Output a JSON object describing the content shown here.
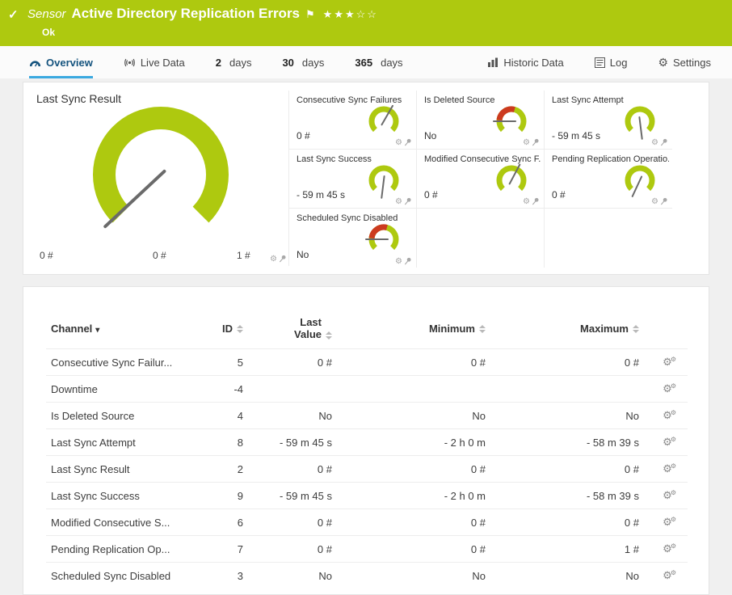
{
  "colors": {
    "brand_green": "#AEC90F",
    "accent_blue": "#3BA9E0",
    "gauge_red": "#CC3A1F",
    "needle": "#6A6A6A"
  },
  "icons": {
    "gear": "⚙",
    "caret_down": "▾"
  },
  "header": {
    "check_icon": "✓",
    "type_label": "Sensor",
    "title": "Active Directory Replication Errors",
    "flag_icon": "⚑",
    "rating": "★★★☆☆",
    "status": "Ok"
  },
  "tabs": {
    "overview": "Overview",
    "live_data": "Live Data",
    "days2_num": "2",
    "days2_label": "days",
    "days30_num": "30",
    "days30_label": "days",
    "days365_num": "365",
    "days365_label": "days",
    "historic": "Historic Data",
    "log": "Log",
    "settings": "Settings"
  },
  "main_gauge": {
    "title": "Last Sync Result",
    "min": "0 #",
    "value": "0 #",
    "max": "1 #",
    "type": "needle",
    "needle_deg": 137
  },
  "small_gauges": [
    {
      "title": "Consecutive Sync Failures",
      "value": "0 #",
      "type": "needle",
      "needle_deg": 300
    },
    {
      "title": "Is Deleted Source",
      "value": "No",
      "type": "boolean",
      "needle_deg": 180
    },
    {
      "title": "Last Sync Attempt",
      "value": "- 59 m 45 s",
      "type": "needle",
      "needle_deg": 83
    },
    {
      "title": "Last Sync Success",
      "value": "- 59 m 45 s",
      "type": "needle",
      "needle_deg": 97
    },
    {
      "title": "Modified Consecutive Sync F...",
      "value": "0 #",
      "type": "needle",
      "needle_deg": 298
    },
    {
      "title": "Pending Replication Operatio...",
      "value": "0 #",
      "type": "needle",
      "needle_deg": 115
    },
    {
      "title": "Scheduled Sync Disabled",
      "value": "No",
      "type": "boolean",
      "needle_deg": 180
    }
  ],
  "table": {
    "headers": {
      "channel": "Channel",
      "id": "ID",
      "last_value": "Last Value",
      "minimum": "Minimum",
      "maximum": "Maximum"
    },
    "rows": [
      {
        "channel": "Consecutive Sync Failur...",
        "id": "5",
        "last": "0 #",
        "min": "0 #",
        "max": "0 #"
      },
      {
        "channel": "Downtime",
        "id": "-4",
        "last": "",
        "min": "",
        "max": ""
      },
      {
        "channel": "Is Deleted Source",
        "id": "4",
        "last": "No",
        "min": "No",
        "max": "No"
      },
      {
        "channel": "Last Sync Attempt",
        "id": "8",
        "last": "- 59 m 45 s",
        "min": "- 2 h 0 m",
        "max": "- 58 m 39 s"
      },
      {
        "channel": "Last Sync Result",
        "id": "2",
        "last": "0 #",
        "min": "0 #",
        "max": "0 #"
      },
      {
        "channel": "Last Sync Success",
        "id": "9",
        "last": "- 59 m 45 s",
        "min": "- 2 h 0 m",
        "max": "- 58 m 39 s"
      },
      {
        "channel": "Modified Consecutive S...",
        "id": "6",
        "last": "0 #",
        "min": "0 #",
        "max": "0 #"
      },
      {
        "channel": "Pending Replication Op...",
        "id": "7",
        "last": "0 #",
        "min": "0 #",
        "max": "1 #"
      },
      {
        "channel": "Scheduled Sync Disabled",
        "id": "3",
        "last": "No",
        "min": "No",
        "max": "No"
      }
    ]
  }
}
